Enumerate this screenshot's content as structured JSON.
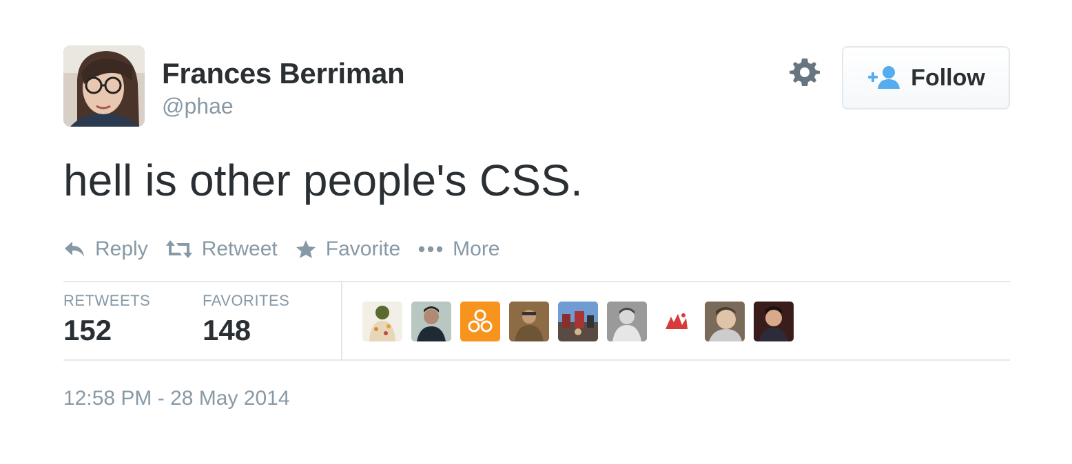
{
  "author": {
    "fullname": "Frances Berriman",
    "username": "@phae"
  },
  "follow_button": {
    "label": "Follow",
    "icon": "add-user-icon"
  },
  "settings_icon": "gear-icon",
  "tweet_text": "hell is other people's CSS.",
  "actions": [
    {
      "label": "Reply",
      "icon": "reply-icon"
    },
    {
      "label": "Retweet",
      "icon": "retweet-icon"
    },
    {
      "label": "Favorite",
      "icon": "star-icon"
    },
    {
      "label": "More",
      "icon": "ellipsis-icon"
    }
  ],
  "stats": {
    "retweets": {
      "label": "RETWEETS",
      "value": "152"
    },
    "favorites": {
      "label": "FAVORITES",
      "value": "148"
    }
  },
  "timestamp": "12:58 PM - 28 May 2014",
  "colors": {
    "text": "#292f33",
    "muted": "#8899a6",
    "border": "#e1e8ed",
    "link_blue": "#55acee"
  }
}
